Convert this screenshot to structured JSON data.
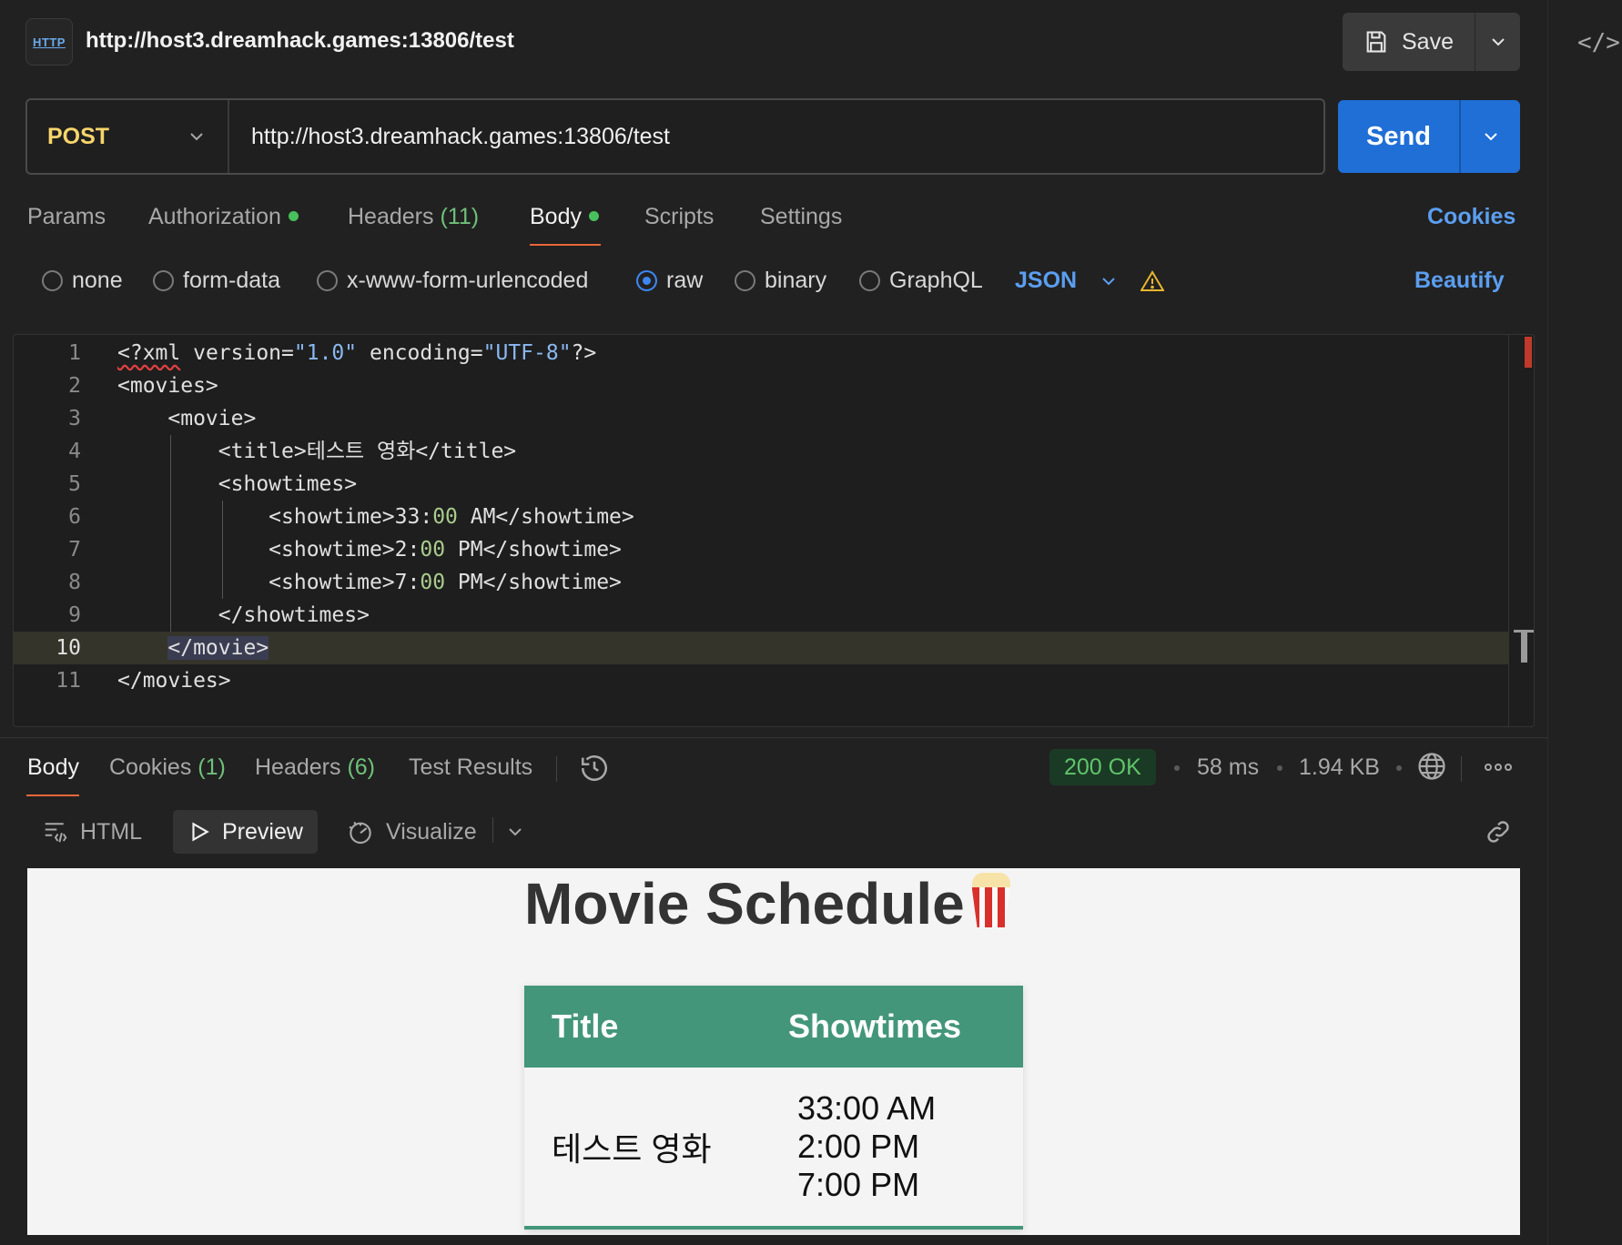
{
  "request": {
    "title": "http://host3.dreamhack.games:13806/test",
    "http_icon_label": "HTTP",
    "save_label": "Save",
    "method": "POST",
    "url": "http://host3.dreamhack.games:13806/test",
    "send_label": "Send"
  },
  "request_tabs": [
    {
      "label": "Params"
    },
    {
      "label": "Authorization",
      "dot": true
    },
    {
      "label": "Headers",
      "count": "(11)"
    },
    {
      "label": "Body",
      "dot": true,
      "active": true
    },
    {
      "label": "Scripts"
    },
    {
      "label": "Settings"
    }
  ],
  "cookies_label": "Cookies",
  "body_options": [
    {
      "label": "none",
      "selected": false
    },
    {
      "label": "form-data",
      "selected": false
    },
    {
      "label": "x-www-form-urlencoded",
      "selected": false
    },
    {
      "label": "raw",
      "selected": true
    },
    {
      "label": "binary",
      "selected": false
    },
    {
      "label": "GraphQL",
      "selected": false
    }
  ],
  "body_type": "JSON",
  "beautify_label": "Beautify",
  "editor_lines": [
    {
      "n": "1",
      "text": "<?xml version=\"1.0\" encoding=\"UTF-8\"?>"
    },
    {
      "n": "2",
      "text": "<movies>"
    },
    {
      "n": "3",
      "text": "    <movie>"
    },
    {
      "n": "4",
      "text": "        <title>테스트 영화</title>"
    },
    {
      "n": "5",
      "text": "        <showtimes>"
    },
    {
      "n": "6",
      "text": "            <showtime>33:00 AM</showtime>"
    },
    {
      "n": "7",
      "text": "            <showtime>2:00 PM</showtime>"
    },
    {
      "n": "8",
      "text": "            <showtime>7:00 PM</showtime>"
    },
    {
      "n": "9",
      "text": "        </showtimes>"
    },
    {
      "n": "10",
      "text": "    </movie>"
    },
    {
      "n": "11",
      "text": "</movies>"
    }
  ],
  "response_tabs": [
    {
      "label": "Body",
      "active": true
    },
    {
      "label": "Cookies",
      "count": "(1)"
    },
    {
      "label": "Headers",
      "count": "(6)"
    },
    {
      "label": "Test Results"
    }
  ],
  "response_meta": {
    "status": "200 OK",
    "time": "58 ms",
    "size": "1.94 KB"
  },
  "preview_toolbar": {
    "html_label": "HTML",
    "preview_label": "Preview",
    "visualize_label": "Visualize"
  },
  "preview_page": {
    "heading": "Movie Schedule",
    "col_title": "Title",
    "col_showtimes": "Showtimes",
    "movie_title": "테스트 영화",
    "showtimes": [
      "33:00 AM",
      "2:00 PM",
      "7:00 PM"
    ]
  },
  "colors": {
    "accent_blue": "#1f6fd6",
    "method_yellow": "#f8d56b",
    "status_green": "#60c46b",
    "tab_underline": "#e8663a",
    "table_header": "#43967a"
  }
}
